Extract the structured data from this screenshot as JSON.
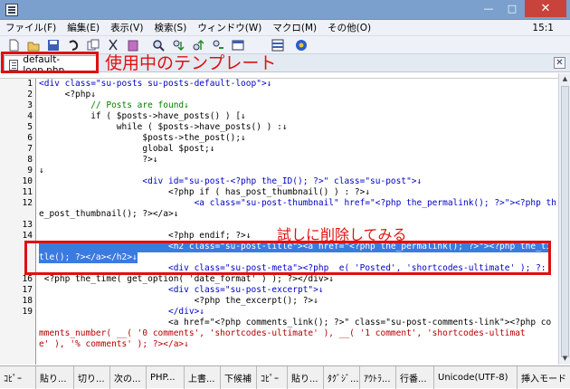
{
  "titlebar": {
    "min_icon": "—",
    "max_icon": "□",
    "close_icon": "✕"
  },
  "menubar": {
    "items": [
      "ファイル(F)",
      "編集(E)",
      "表示(V)",
      "検索(S)",
      "ウィンドウ(W)",
      "マクロ(M)",
      "その他(O)"
    ],
    "cursor_position": "15:1"
  },
  "toolbar": {
    "icons": [
      "new-file-icon",
      "open-folder-icon",
      "save-icon",
      "undo-icon",
      "copy-icon",
      "cut-icon",
      "paste-icon",
      "search-icon",
      "find-next-down-icon",
      "find-prev-up-icon",
      "replace-icon",
      "window-icon",
      "split-icon",
      "help-icon"
    ]
  },
  "tab": {
    "label": "default-loop.php",
    "close_icon": "✕"
  },
  "annotations": {
    "tab_note": "使用中のテンプレート",
    "edit_note": "試しに削除してみる"
  },
  "editor": {
    "line_numbers": [
      "1",
      "2",
      "3",
      "4",
      "5",
      "6",
      "7",
      "8",
      "9",
      "10",
      "11",
      "12",
      "",
      "13",
      "14",
      "",
      "",
      "16",
      "17",
      "18",
      "19",
      "",
      ""
    ],
    "lines": [
      "<div class=\"su-posts su-posts-default-loop\">↓",
      "     <?php↓",
      "          // Posts are found↓",
      "          if ( $posts->have_posts() ) [↓",
      "               while ( $posts->have_posts() ) :↓",
      "                    $posts->the_post();↓",
      "                    global $post;↓",
      "                    ?>↓",
      "↓",
      "                    <div id=\"su-post-<?php the_ID(); ?>\" class=\"su-post\">↓",
      "                         <?php if ( has_post_thumbnail() ) : ?>↓",
      "                              <a class=\"su-post-thumbnail\" href=\"<?php the_permalink(); ?>\"><?php th",
      "e_post_thumbnail(); ?></a>↓",
      "                         <?php endif; ?>↓",
      "                         <h2 class=\"su-post-title\"><a href=\"<?php the_permalink(); ?>\"><?php the_ti",
      "tle(); ?></a></h2>↓",
      "                         <div class=\"su-post-meta\"><?php _e( 'Posted', 'shortcodes-ultimate' ); ?:",
      " <?php the_time( get_option( 'date_format' ) ); ?></div>↓",
      "                         <div class=\"su-post-excerpt\">↓",
      "                              <?php the_excerpt(); ?>↓",
      "                         </div>↓",
      "                         <a href=\"<?php comments_link(); ?>\" class=\"su-post-comments-link\"><?php co",
      "mments_number( __( '0 comments', 'shortcodes-ultimate' ), __( '1 comment', 'shortcodes-ultimat",
      "e' ), '% comments' ); ?></a>↓"
    ]
  },
  "statusbar": {
    "items": [
      "ｺﾋﾟｰ",
      "貼り...",
      "切り...",
      "次の...",
      "PHP...",
      "上書...",
      "下候補",
      "ｺﾋﾟｰ",
      "貼り...",
      "ﾀｸﾞｼﾞ...",
      "ｱｳﾄﾗ...",
      "行番...",
      "Unicode(UTF-8)",
      "挿入モード"
    ]
  }
}
